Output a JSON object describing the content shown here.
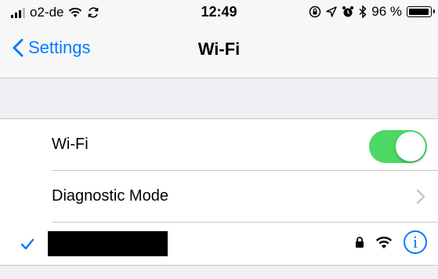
{
  "status_bar": {
    "carrier": "o2-de",
    "time": "12:49",
    "battery": "96 %",
    "battery_level": 0.96
  },
  "nav": {
    "back_label": "Settings",
    "title": "Wi-Fi"
  },
  "rows": {
    "wifi_label": "Wi-Fi",
    "wifi_on": true,
    "diagnostic_label": "Diagnostic Mode",
    "info_glyph": "i"
  },
  "colors": {
    "accent": "#007aff",
    "toggle_on": "#4cd964",
    "background": "#efeff4"
  },
  "icons": [
    "signal-bars-icon",
    "wifi-icon",
    "sync-icon",
    "rotation-lock-icon",
    "location-arrow-icon",
    "alarm-icon",
    "bluetooth-icon",
    "battery-icon",
    "back-chevron-icon",
    "chevron-right-icon",
    "checkmark-icon",
    "lock-icon",
    "info-icon"
  ]
}
